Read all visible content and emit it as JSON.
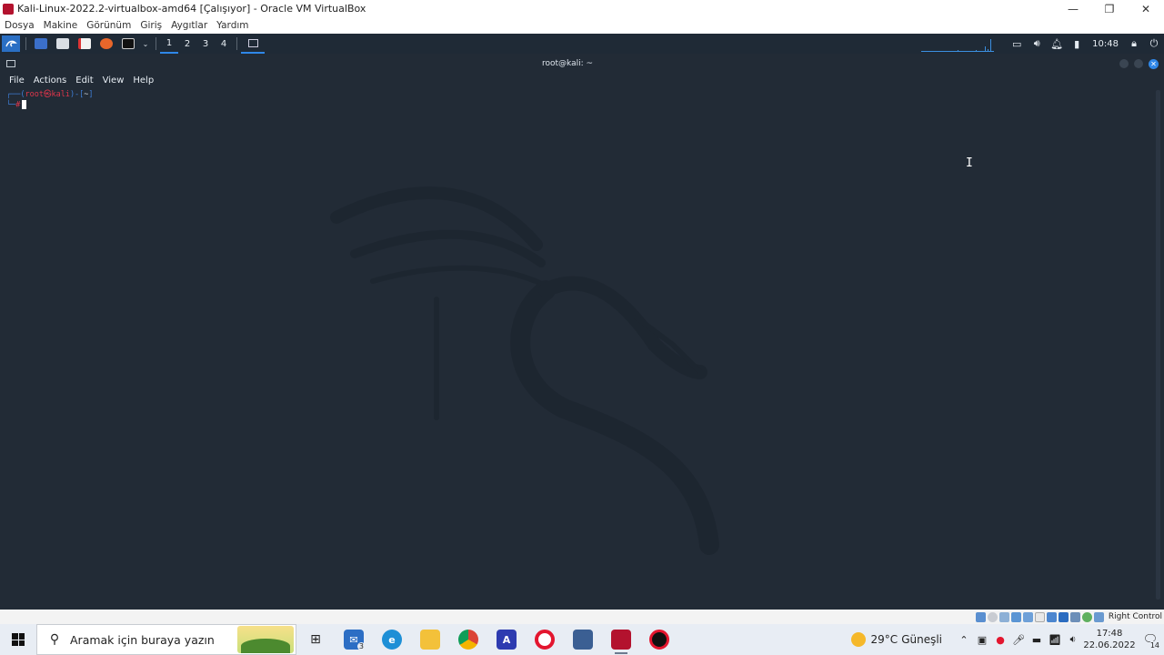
{
  "vbox": {
    "window_title": "Kali-Linux-2022.2-virtualbox-amd64 [Çalışıyor] - Oracle VM VirtualBox",
    "minimize_glyph": "—",
    "restore_glyph": "❐",
    "close_glyph": "✕",
    "menu": [
      "Dosya",
      "Makine",
      "Görünüm",
      "Giriş",
      "Aygıtlar",
      "Yardım"
    ],
    "host_key_label": "Right Control"
  },
  "kali_panel": {
    "workspaces": [
      "1",
      "2",
      "3",
      "4"
    ],
    "active_workspace": "1",
    "time": "10:48"
  },
  "terminal": {
    "window_title": "root@kali: ~",
    "menu": [
      "File",
      "Actions",
      "Edit",
      "View",
      "Help"
    ],
    "prompt_top_frame": "┌──(",
    "prompt_user_host": "root㉿kali",
    "prompt_mid": ")-[",
    "prompt_dir": "~",
    "prompt_end": "]",
    "prompt_bottom_frame": "└─",
    "prompt_hash": "#",
    "close_glyph": "✕"
  },
  "taskbar": {
    "search_placeholder": "Aramak için buraya yazın",
    "mail_badge": "3",
    "weather_temp": "29°C",
    "weather_desc": "Güneşli",
    "clock_time": "17:48",
    "clock_date": "22.06.2022",
    "notification_count": "14"
  },
  "colors": {
    "kali_panel_bg": "#1f2a36",
    "desktop_bg": "#222b36",
    "accent_blue": "#2f87e8",
    "prompt_red": "#e0364b"
  }
}
